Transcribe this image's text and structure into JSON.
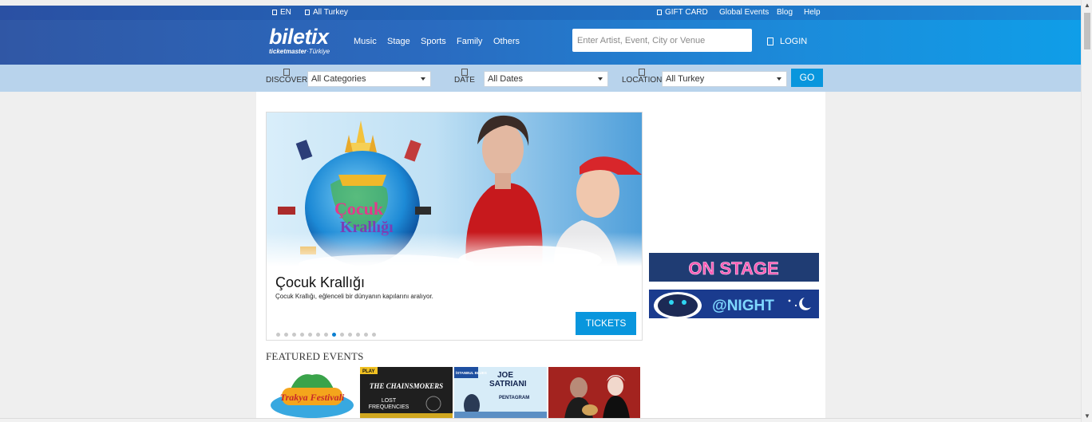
{
  "topbar": {
    "language": "EN",
    "region": "All Turkey",
    "gift_card": "GIFT CARD",
    "global_events": "Global Events",
    "blog": "Blog",
    "help": "Help"
  },
  "header": {
    "logo_main": "biletix",
    "logo_sub_bold": "ticketmaster",
    "logo_sub_light": "·Türkiye",
    "nav": [
      "Music",
      "Stage",
      "Sports",
      "Family",
      "Others"
    ],
    "search_placeholder": "Enter Artist, Event, City or Venue",
    "login": "LOGIN"
  },
  "filters": {
    "discover_label": "DISCOVER",
    "discover_value": "All Categories",
    "date_label": "DATE",
    "date_value": "All Dates",
    "location_label": "LOCATION",
    "location_value": "All Turkey",
    "go": "GO"
  },
  "slider": {
    "title": "Çocuk Krallığı",
    "description": "Çocuk Krallığı, eğlenceli bir dünyanın kapılarını aralıyor.",
    "tickets": "TICKETS",
    "dot_count": 13,
    "active_dot": 8,
    "hero_logo_line1": "Çocuk",
    "hero_logo_line2": "Krallığı"
  },
  "banners": {
    "on_stage": "ON STAGE",
    "at_night": "@NIGHT"
  },
  "featured": {
    "title": "FEATURED EVENTS",
    "event1": "Trakya Festivali",
    "event2_tag": "PLAY",
    "event2_line1": "THE CHAINSMOKERS",
    "event2_line2": "LOST",
    "event2_line3": "FREQUENCIES",
    "event3_tag": "İSTANBUL BLUES",
    "event3_line1": "JOE",
    "event3_line2": "SATRIANI",
    "event3_line3": "PENTAGRAM"
  },
  "colors": {
    "accent": "#0996dd",
    "header_left": "#3057a5",
    "header_right": "#0f9ee8",
    "filter_bg": "#b8d3ec"
  }
}
